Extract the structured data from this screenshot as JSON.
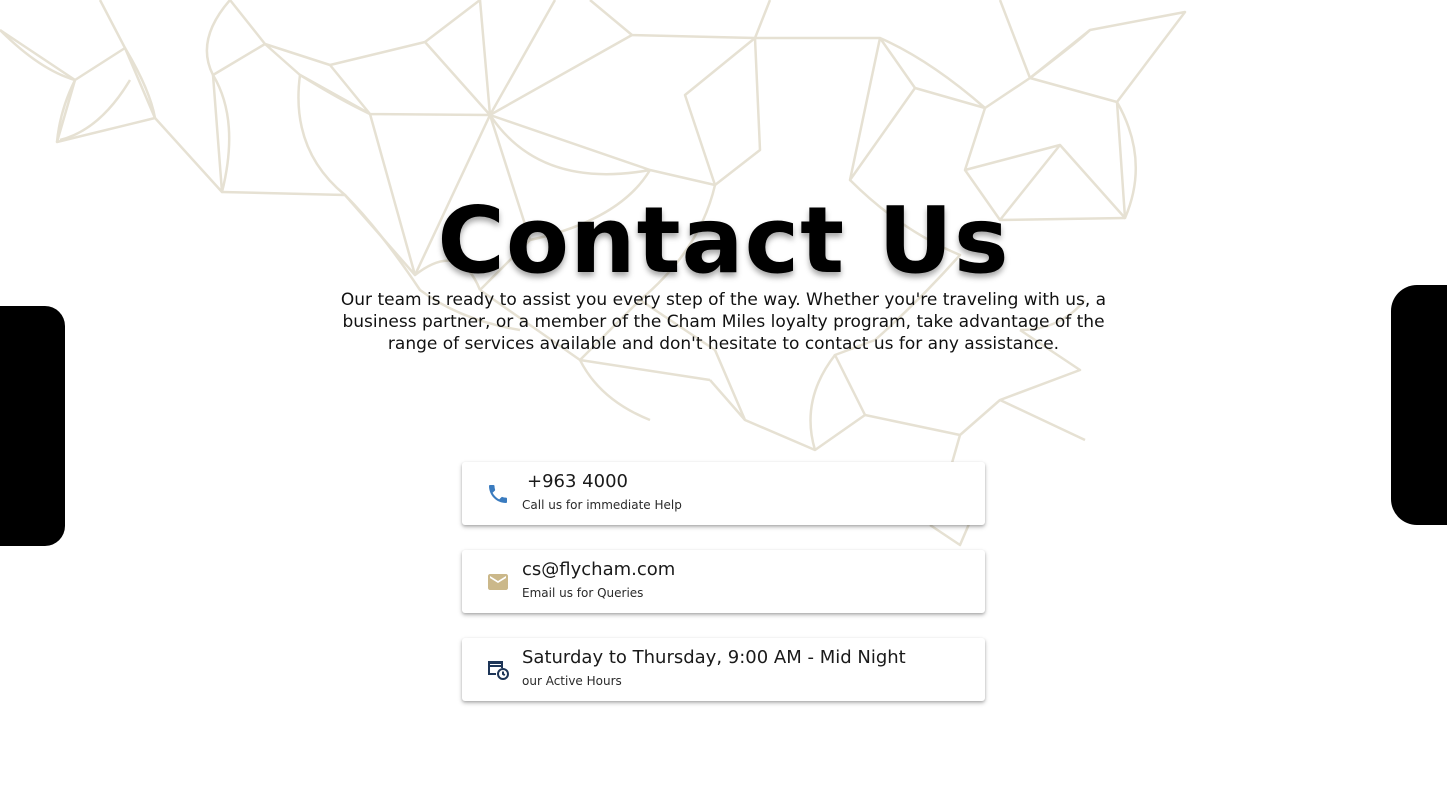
{
  "header": {
    "title": "Contact Us",
    "description": "Our team is ready to assist you every step of the way. Whether you're traveling with us, a business partner, or a member of the Cham Miles loyalty program, take advantage of the range of services available and don't hesitate to contact us for any assistance."
  },
  "contacts": [
    {
      "icon": "phone-icon",
      "value": "+963 4000",
      "caption": "Call us for immediate Help",
      "icon_color": "#3a7bbf"
    },
    {
      "icon": "mail-icon",
      "value": "cs@flycham.com",
      "caption": "Email us for Queries",
      "icon_color": "#cbb88a"
    },
    {
      "icon": "schedule-icon",
      "value": "Saturday to Thursday, 9:00 AM - Mid Night",
      "caption": "our Active Hours",
      "icon_color": "#1d3557"
    }
  ],
  "colors": {
    "pattern_line": "#e6e1d3",
    "side_tabs": "#000000",
    "text": "#111111"
  }
}
